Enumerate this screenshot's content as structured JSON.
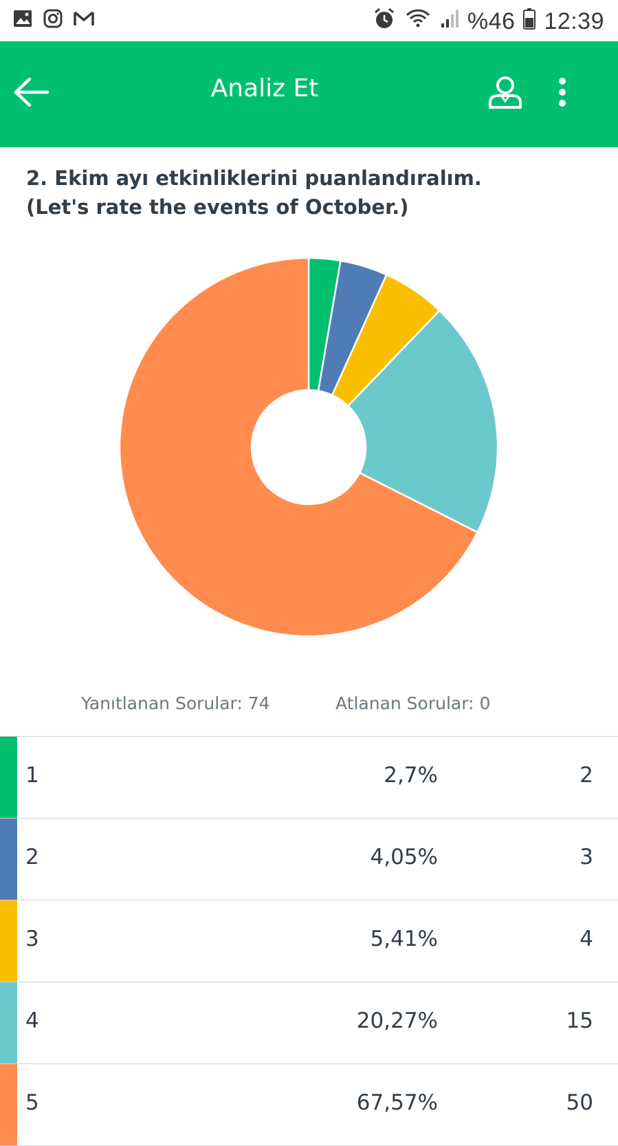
{
  "status_bar": {
    "battery": "%46",
    "time": "12:39",
    "icons": [
      "gallery-icon",
      "instagram-icon",
      "gmail-icon",
      "alarm-icon",
      "wifi-icon",
      "signal-icon",
      "battery-icon"
    ]
  },
  "app_bar": {
    "title": "Analiz Et",
    "color": "#00bf6f",
    "icons": [
      "back-arrow-icon",
      "user-profile-icon",
      "more-vert-icon"
    ]
  },
  "question": {
    "line1": "2. Ekim ayı etkinliklerini puanlandıralım.",
    "line2": "(Let's rate the events of October.)"
  },
  "stats": {
    "answered": "Yanıtlanan Sorular: 74",
    "skipped": "Atlanan Sorular: 0"
  },
  "rows": [
    {
      "label": "1",
      "percent": "2,7%",
      "count": "2",
      "color": "#00bf6f"
    },
    {
      "label": "2",
      "percent": "4,05%",
      "count": "3",
      "color": "#507cb6"
    },
    {
      "label": "3",
      "percent": "5,41%",
      "count": "4",
      "color": "#f9be00"
    },
    {
      "label": "4",
      "percent": "20,27%",
      "count": "15",
      "color": "#6bc8cd"
    },
    {
      "label": "5",
      "percent": "67,57%",
      "count": "50",
      "color": "#ff8b4f"
    }
  ],
  "chart_data": {
    "type": "pie",
    "categories": [
      "1",
      "2",
      "3",
      "4",
      "5"
    ],
    "values": [
      2,
      3,
      4,
      15,
      50
    ],
    "percents": [
      2.7,
      4.05,
      5.41,
      20.27,
      67.57
    ],
    "colors": [
      "#00bf6f",
      "#507cb6",
      "#f9be00",
      "#6bc8cd",
      "#ff8b4f"
    ],
    "donut": true
  }
}
